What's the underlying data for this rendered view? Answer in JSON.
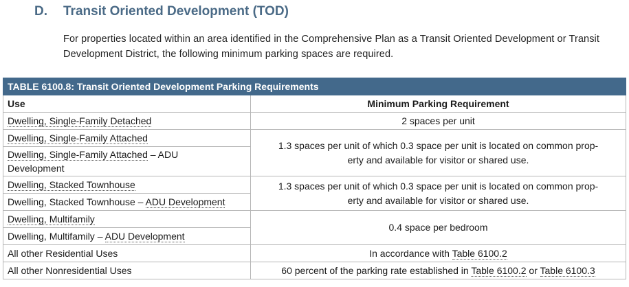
{
  "section": {
    "letter": "D.",
    "title": "Transit Oriented Development (TOD)",
    "intro": "For properties located within an area identified in the Comprehensive Plan as a Transit Oriented Development or Transit Development District, the following minimum parking spaces are required."
  },
  "table": {
    "title": "TABLE 6100.8: Transit Oriented Development Parking Requirements",
    "col_use": "Use",
    "col_req": "Minimum Parking Requirement",
    "rows": [
      {
        "use_a": "Dwelling, Single-Family Detached",
        "req": "2 spaces per unit"
      },
      {
        "use_a": "Dwelling, Single-Family Attached"
      },
      {
        "use_a": "Dwelling, Single-Family Attached",
        "use_b": " – ADU",
        "use_c": "Development"
      },
      {
        "use_a": "Dwelling, Stacked Townhouse"
      },
      {
        "use_a": "Dwelling, Stacked Townhouse – ",
        "use_b": "ADU Development"
      },
      {
        "use_a": "Dwelling, Multifamily"
      },
      {
        "use_a": "Dwelling, Multifamily – ",
        "use_b": "ADU Development"
      },
      {
        "use_a": "All other Residential Uses",
        "req_a": "In accordance with ",
        "req_b": "Table 6100.2"
      },
      {
        "use_a": "All other Nonresidential Uses",
        "req_a": "60 percent of the parking rate established in ",
        "req_b": "Table 6100.2",
        "req_c": " or ",
        "req_d": "Table 6100.3"
      }
    ],
    "merged": {
      "sfa_req_line1": "1.3 spaces per unit of which 0.3 space per unit is located on common prop-",
      "sfa_req_line2": "erty and available for visitor or shared use.",
      "st_req_line1": "1.3 spaces per unit of which 0.3 space per unit is located on common prop-",
      "st_req_line2": "erty and available for visitor or shared use.",
      "mf_req": "0.4 space per bedroom"
    }
  }
}
